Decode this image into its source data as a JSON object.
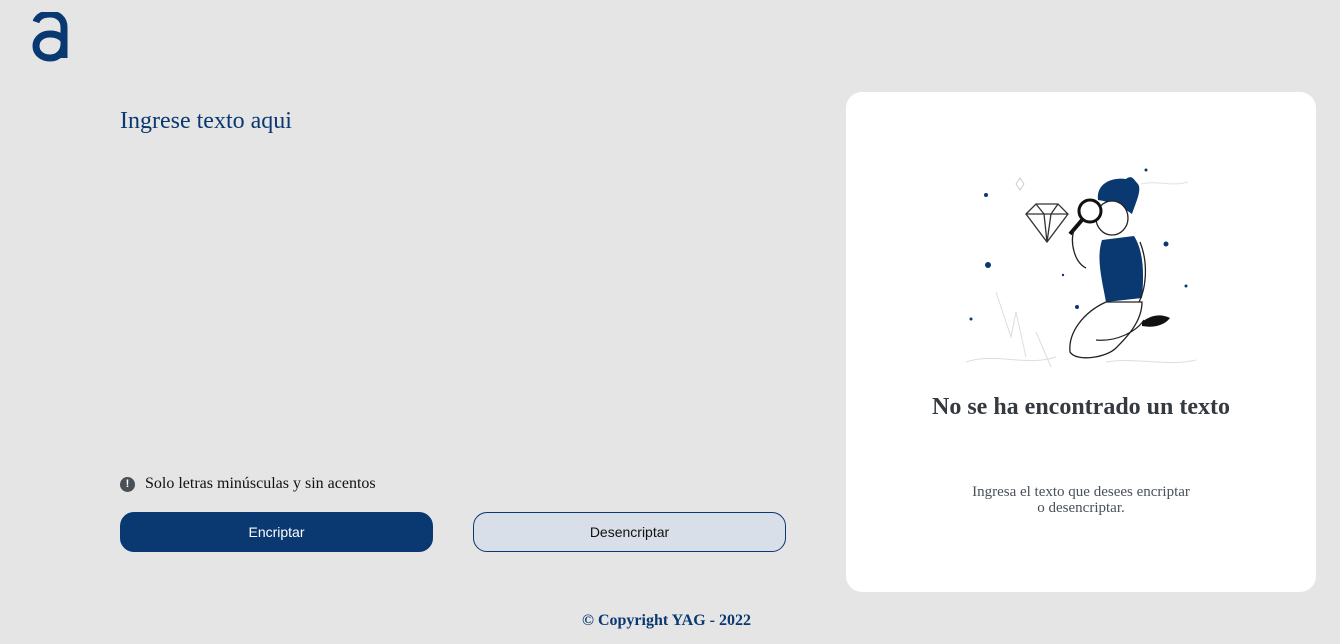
{
  "logo": {
    "icon": "alura-logo-icon",
    "color": "#0a3871"
  },
  "input": {
    "placeholder": "Ingrese texto aqui",
    "value": ""
  },
  "hint": {
    "icon": "exclamation-icon",
    "icon_glyph": "!",
    "text": "Solo letras minúsculas y sin acentos"
  },
  "buttons": {
    "encrypt_label": "Encriptar",
    "decrypt_label": "Desencriptar"
  },
  "result_panel": {
    "illustration": "boy-with-magnifying-glass-illustration",
    "title": "No se ha encontrado un texto",
    "description_line1": "Ingresa el texto que desees encriptar",
    "description_line2": "o desencriptar."
  },
  "footer": {
    "text": "© Copyright YAG - 2022"
  },
  "colors": {
    "accent": "#0a3871",
    "background": "#e5e5e5",
    "panel": "#ffffff",
    "secondary_button": "#d8dfe8"
  }
}
